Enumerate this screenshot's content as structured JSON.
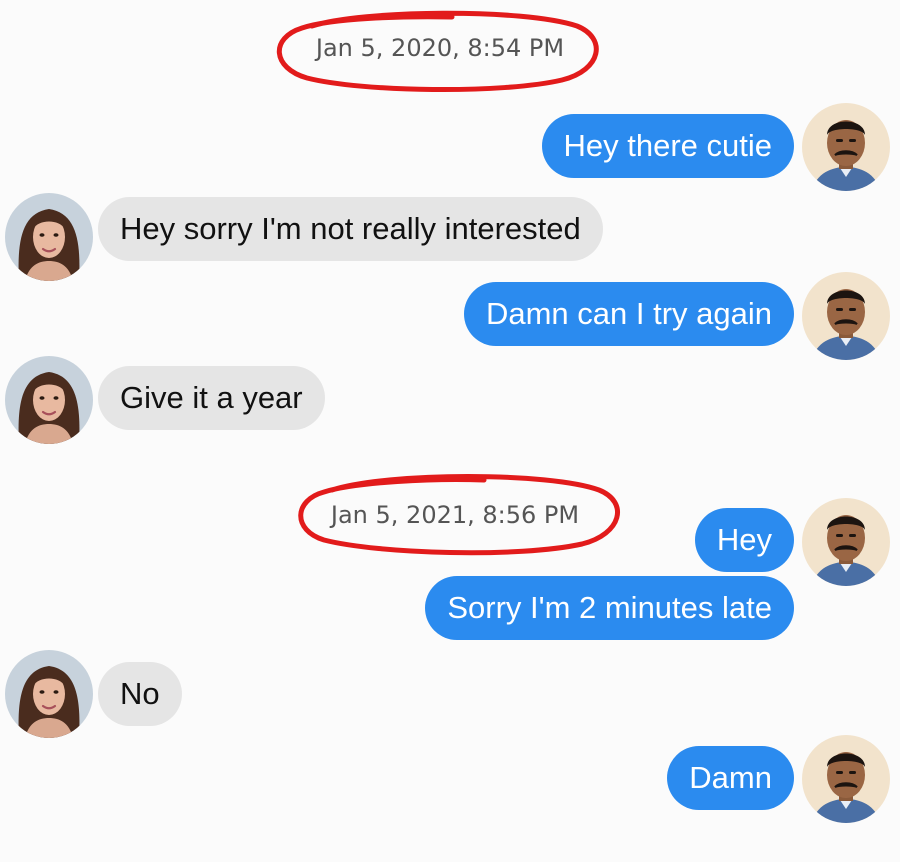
{
  "timestamps": [
    "Jan 5, 2020, 8:54 PM",
    "Jan 5, 2021, 8:56 PM"
  ],
  "messages": [
    {
      "sender": "me",
      "text": "Hey there cutie"
    },
    {
      "sender": "her",
      "text": "Hey sorry I'm not really interested"
    },
    {
      "sender": "me",
      "text": "Damn can I try again"
    },
    {
      "sender": "her",
      "text": "Give it a year"
    },
    {
      "sender": "me",
      "text": "Hey"
    },
    {
      "sender": "me",
      "text": "Sorry I'm 2 minutes late"
    },
    {
      "sender": "her",
      "text": "No"
    },
    {
      "sender": "me",
      "text": "Damn"
    }
  ],
  "colors": {
    "outgoing_bubble": "#2b8bef",
    "incoming_bubble": "#e5e5e5",
    "annotation_circle": "#e21b1b"
  }
}
